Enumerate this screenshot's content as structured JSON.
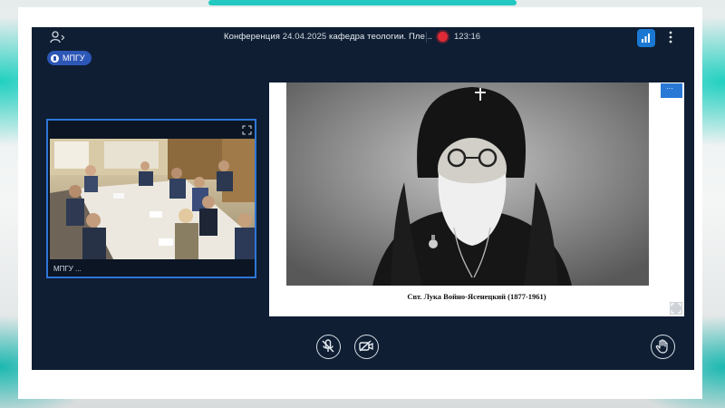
{
  "window": {
    "title": "Конференция",
    "date": "24.04.2025",
    "subtitle": "кафедра теологии. Пле...",
    "timer": "123:16",
    "recording": true
  },
  "organization": {
    "badge": "МПГУ"
  },
  "participant": {
    "name": "МПГУ ..."
  },
  "slide": {
    "caption": "Свт. Лука Войно-Ясенецкий (1877-1961)"
  },
  "controls": {
    "items": [
      "microphone-muted-icon",
      "camera-off-icon",
      "raise-hand-icon"
    ]
  },
  "colors": {
    "app_bg": "#0f1e33",
    "accent": "#2e76d8",
    "record": "#e02a36",
    "teal_frame": "#23c9c0"
  }
}
